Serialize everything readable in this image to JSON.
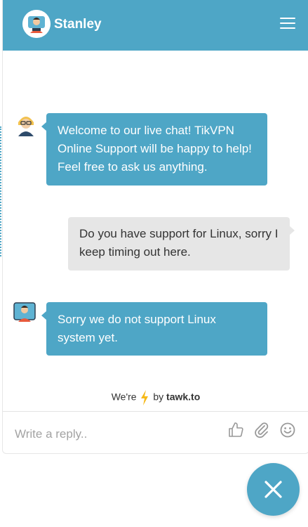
{
  "header": {
    "agent_name": "Stanley",
    "menu_icon": "hamburger-menu-icon"
  },
  "messages": [
    {
      "from": "agent",
      "text": "Welcome to our live chat! TikVPN Online Support will be happy to help! Feel free to ask us anything."
    },
    {
      "from": "visitor",
      "text": "Do you have support for Linux, sorry I keep timing out here."
    },
    {
      "from": "agent",
      "text": "Sorry we do not support Linux system yet."
    }
  ],
  "powered": {
    "prefix": "We're",
    "by": "by",
    "brand": "tawk.to"
  },
  "composer": {
    "placeholder": "Write a reply..",
    "icons": [
      "thumbs-up-icon",
      "paperclip-icon",
      "smiley-icon"
    ]
  },
  "launcher": {
    "icon": "close-icon"
  },
  "colors": {
    "accent": "#4ea6c6",
    "visitor_bubble": "#e6e6e6",
    "bolt": "#f6b918"
  }
}
